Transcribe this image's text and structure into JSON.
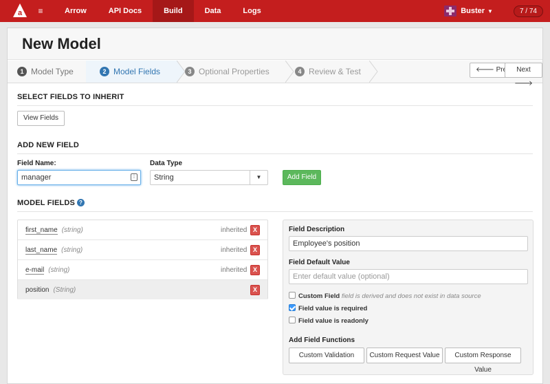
{
  "nav": {
    "items": [
      {
        "label": "Arrow",
        "active": false
      },
      {
        "label": "API Docs",
        "active": false
      },
      {
        "label": "Build",
        "active": true
      },
      {
        "label": "Data",
        "active": false
      },
      {
        "label": "Logs",
        "active": false
      }
    ],
    "user_name": "Buster",
    "counter": "7 / 74",
    "accent": "#c41e1e"
  },
  "page": {
    "title": "New Model"
  },
  "steps": [
    {
      "num": "1",
      "label": "Model Type"
    },
    {
      "num": "2",
      "label": "Model Fields"
    },
    {
      "num": "3",
      "label": "Optional Properties"
    },
    {
      "num": "4",
      "label": "Review & Test"
    }
  ],
  "pager": {
    "prev": "Prev",
    "next": "Next"
  },
  "inherit": {
    "heading": "SELECT FIELDS TO INHERIT",
    "button": "View Fields"
  },
  "add_field": {
    "heading": "ADD NEW FIELD",
    "name_label": "Field Name:",
    "name_value": "manager",
    "type_label": "Data Type",
    "type_value": "String",
    "button": "Add Field"
  },
  "model_fields": {
    "heading": "MODEL FIELDS",
    "rows": [
      {
        "name": "first_name",
        "type": "(string)",
        "status": "inherited"
      },
      {
        "name": "last_name",
        "type": "(string)",
        "status": "inherited"
      },
      {
        "name": "e-mail",
        "type": "(string)",
        "status": "inherited"
      },
      {
        "name": "position",
        "type": "(String)",
        "status": ""
      }
    ],
    "delete_label": "X"
  },
  "detail": {
    "desc_label": "Field Description",
    "desc_value": "Employee's position",
    "default_label": "Field Default Value",
    "default_placeholder": "Enter default value (optional)",
    "custom_label": "Custom Field",
    "custom_note": "field is derived and does not exist in data source",
    "required_label": "Field value is required",
    "readonly_label": "Field value is readonly",
    "functions_label": "Add Field Functions",
    "fn_validation": "Custom Validation",
    "fn_request": "Custom Request Value",
    "fn_response": "Custom Response Value"
  }
}
